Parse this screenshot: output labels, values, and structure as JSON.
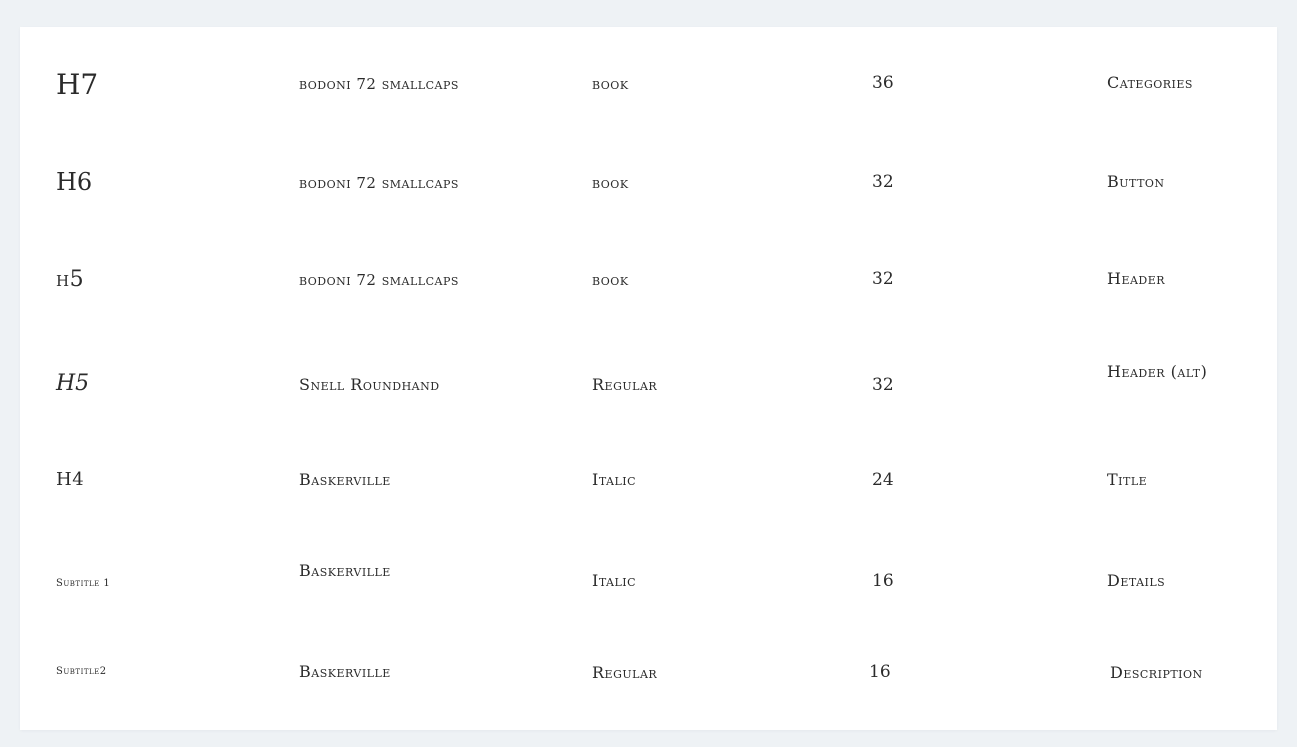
{
  "rows": [
    {
      "style": "H7",
      "font": "bodoni 72 smallcaps",
      "weight": "book",
      "size": "36",
      "usage": "Categories"
    },
    {
      "style": "H6",
      "font": "bodoni 72 smallcaps",
      "weight": "book",
      "size": "32",
      "usage": "Button"
    },
    {
      "style": "h5",
      "font": "bodoni 72 smallcaps",
      "weight": "book",
      "size": "32",
      "usage": "Header"
    },
    {
      "style": "H5",
      "font": "Snell Roundhand",
      "weight": "Regular",
      "size": "32",
      "usage": "Header (alt)"
    },
    {
      "style": "H4",
      "font": "Baskerville",
      "weight": "Italic",
      "size": "24",
      "usage": "Title"
    },
    {
      "style": "Subtitle 1",
      "font": "Baskerville",
      "weight": "Italic",
      "size": "16",
      "usage": "Details"
    },
    {
      "style": "Subtitle2",
      "font": "Baskerville",
      "weight": "Regular",
      "size": "16",
      "usage": "Description"
    }
  ]
}
